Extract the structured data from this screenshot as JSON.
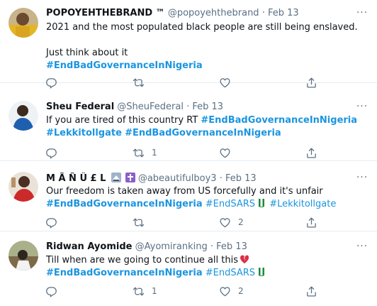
{
  "tweets": [
    {
      "name": "POPOYEHTHEBRAND ™",
      "handle": "@popoyehthebrand",
      "sep": "·",
      "date": "Feb 13",
      "line1": "2021 and the most populated black people are still being enslaved.",
      "line2": "Just think about it",
      "hashtag": "#EndBadGovernanceInNigeria",
      "retweets": "",
      "likes": ""
    },
    {
      "name": "Sheu Federal",
      "handle": "@SheuFederal",
      "sep": "·",
      "date": "Feb 13",
      "line1_text": "If you are tired of this country RT ",
      "hashtag1": "#EndBadGovernanceInNigeria",
      "hashtag2": "#Lekkitollgate",
      "hashtag3": "#EndBadGovernanceInNigeria",
      "retweets": "1",
      "likes": ""
    },
    {
      "name": "M Ã Ñ Û £ L",
      "handle": "@abeautifulboy3",
      "sep": "·",
      "date": "Feb 13",
      "line1": "Our freedom is taken away from US forcefully and it's unfair",
      "hashtag1": "#EndBadGovernanceInNigeria",
      "hashtag2": "#EndSARS",
      "hashtag3": "#Lekkitollgate",
      "retweets": "",
      "likes": "2"
    },
    {
      "name": "Ridwan Ayomide",
      "handle": "@Ayomiranking",
      "sep": "·",
      "date": "Feb 13",
      "line1": "Till when are we going to continue all this",
      "hashtag1": "#EndBadGovernanceInNigeria",
      "hashtag2": "#EndSARS",
      "retweets": "1",
      "likes": "2"
    }
  ],
  "more_glyph": "···",
  "icons": {
    "reply": "reply-icon",
    "retweet": "retweet-icon",
    "like": "heart-icon",
    "share": "share-icon",
    "more": "more-icon"
  },
  "colors": {
    "hashtag": "#1b95e0",
    "meta": "#5b7083",
    "divider": "#e6ecf0"
  }
}
